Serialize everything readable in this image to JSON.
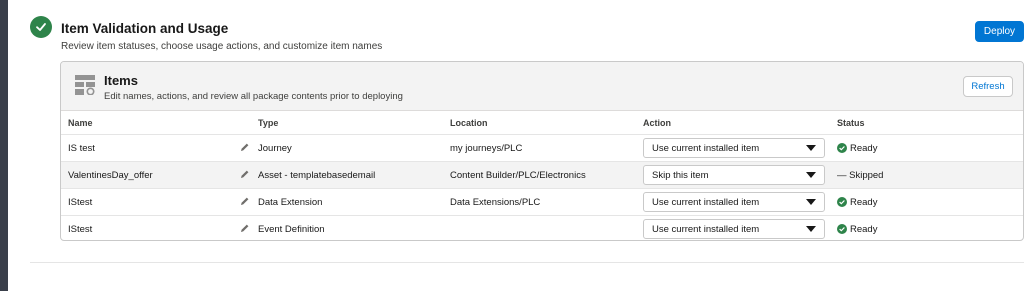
{
  "step": {
    "title": "Item Validation and Usage",
    "subtitle": "Review item statuses, choose usage actions, and customize item names",
    "deploy_label": "Deploy",
    "step_icon": "checkmark-icon",
    "accent_color": "#2e844a",
    "brand_color": "#0176d3"
  },
  "items_panel": {
    "title": "Items",
    "description": "Edit names, actions, and review all package contents prior to deploying",
    "refresh_label": "Refresh",
    "icon": "table-settings-icon"
  },
  "table": {
    "columns": [
      "Name",
      "Type",
      "Location",
      "Action",
      "Status"
    ],
    "rows": [
      {
        "name": "IS test",
        "type": "Journey",
        "location": "my journeys/PLC",
        "action": "Use current installed item",
        "status": "Ready",
        "status_kind": "ready"
      },
      {
        "name": "ValentinesDay_offer",
        "type": "Asset - templatebasedemail",
        "location": "Content Builder/PLC/Electronics",
        "action": "Skip this item",
        "status": "— Skipped",
        "status_kind": "skipped"
      },
      {
        "name": "IStest",
        "type": "Data Extension",
        "location": "Data Extensions/PLC",
        "action": "Use current installed item",
        "status": "Ready",
        "status_kind": "ready"
      },
      {
        "name": "IStest",
        "type": "Event Definition",
        "location": "",
        "action": "Use current installed item",
        "status": "Ready",
        "status_kind": "ready"
      }
    ]
  }
}
